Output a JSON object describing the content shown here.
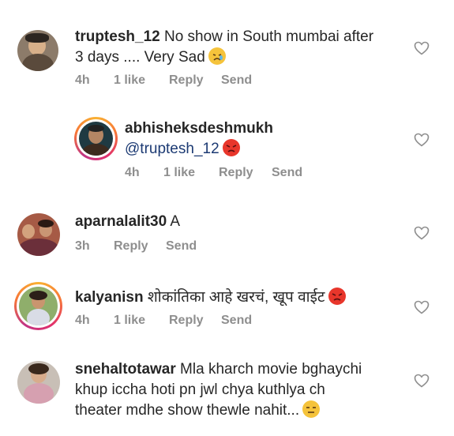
{
  "comments": [
    {
      "username": "truptesh_12",
      "text_line1": "No show in South mumbai after",
      "text_line2": "3 days .... Very Sad",
      "emoji": "crying-face-icon",
      "time": "4h",
      "likes": "1 like",
      "reply": "Reply",
      "send": "Send"
    },
    {
      "username": "abhisheksdeshmukh",
      "mention": "@truptesh_12",
      "emoji": "angry-face-icon",
      "time": "4h",
      "likes": "1 like",
      "reply": "Reply",
      "send": "Send"
    },
    {
      "username": "aparnalalit30",
      "text_line1": "A",
      "time": "3h",
      "reply": "Reply",
      "send": "Send"
    },
    {
      "username": "kalyanisn",
      "text_line1": "शोकांतिका आहे खरचं, खूप वाईट",
      "emoji": "angry-face-icon",
      "time": "4h",
      "likes": "1 like",
      "reply": "Reply",
      "send": "Send"
    },
    {
      "username": "snehaltotawar",
      "text_line1": "Mla kharch movie bghaychi",
      "text_line2": "khup iccha hoti pn jwl chya kuthlya ch",
      "text_line3": "theater mdhe show thewle nahit...",
      "emoji": "unamused-face-icon"
    }
  ],
  "colors": {
    "text": "#262626",
    "meta": "#8e8e8e",
    "mention": "#1c3a73",
    "story_ring": "#e1306c"
  }
}
